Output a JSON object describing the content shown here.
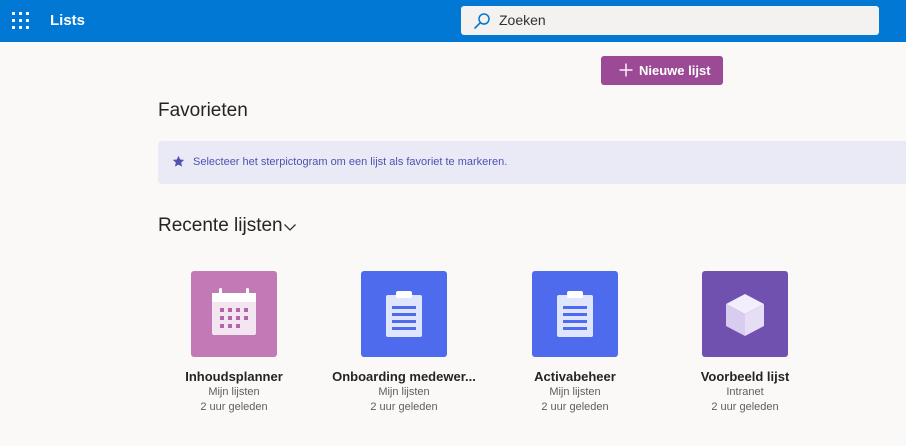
{
  "header": {
    "app_title": "Lists",
    "search_placeholder": "Zoeken"
  },
  "toolbar": {
    "new_list_label": "Nieuwe lijst"
  },
  "favorites": {
    "title": "Favorieten",
    "hint": "Selecteer het sterpictogram om een lijst als favoriet te markeren."
  },
  "recent": {
    "title": "Recente lijsten",
    "items": [
      {
        "name": "Inhoudsplanner",
        "location": "Mijn lijsten",
        "time": "2 uur geleden",
        "icon": "calendar-icon",
        "color": "#c27ab7"
      },
      {
        "name": "Onboarding medewer...",
        "location": "Mijn lijsten",
        "time": "2 uur geleden",
        "icon": "clipboard-icon",
        "color": "#4f6bed"
      },
      {
        "name": "Activabeheer",
        "location": "Mijn lijsten",
        "time": "2 uur geleden",
        "icon": "clipboard-icon",
        "color": "#4f6bed"
      },
      {
        "name": "Voorbeeld lijst",
        "location": "Intranet",
        "time": "2 uur geleden",
        "icon": "cube-icon",
        "color": "#7151b0"
      }
    ]
  },
  "colors": {
    "topbar": "#0078d4",
    "accent_button": "#9c4a96",
    "banner_bg": "#e9eaf6",
    "banner_text": "#4f52b2"
  }
}
